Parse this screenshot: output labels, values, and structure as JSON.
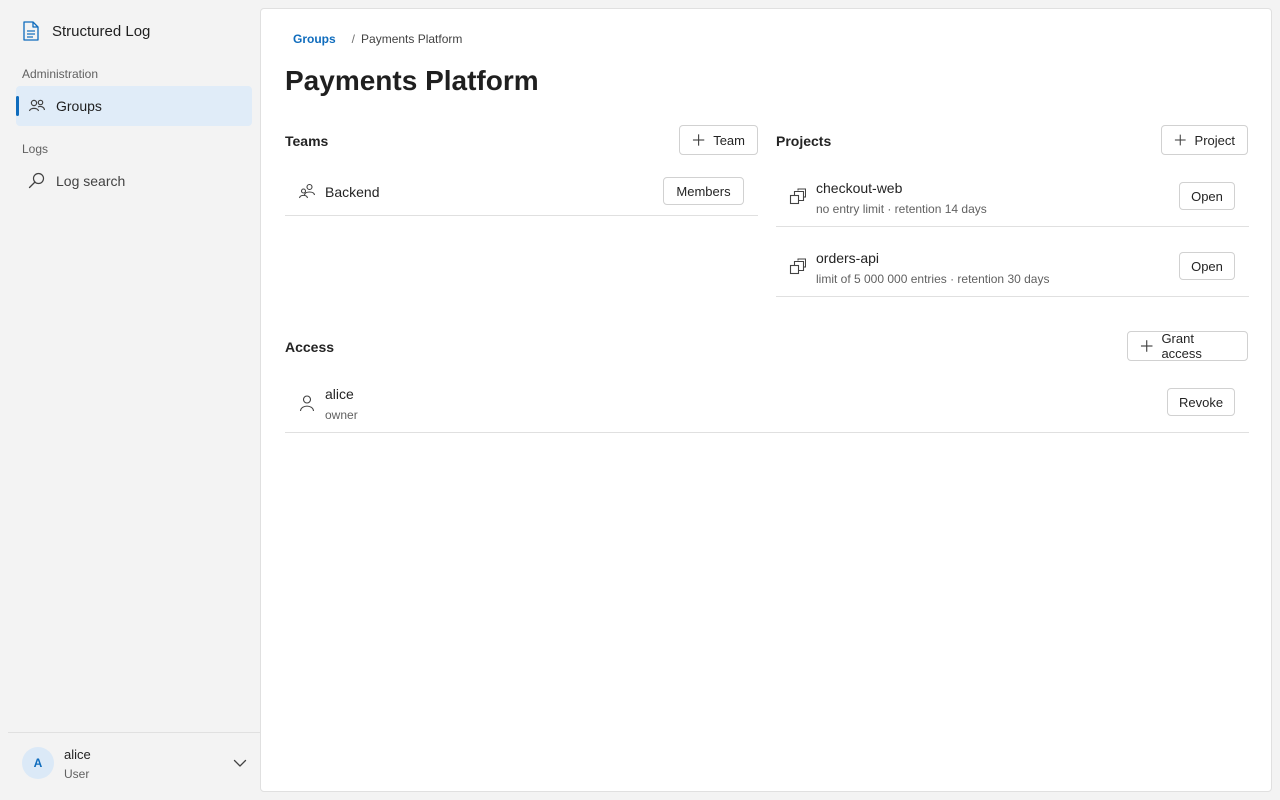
{
  "app": {
    "title": "Structured Log"
  },
  "sidebar": {
    "sections": [
      {
        "heading": "Administration",
        "items": [
          {
            "label": "Groups",
            "icon": "people-icon",
            "active": true
          }
        ]
      },
      {
        "heading": "Logs",
        "items": [
          {
            "label": "Log search",
            "icon": "search-icon",
            "active": false
          }
        ]
      }
    ]
  },
  "user": {
    "initial": "A",
    "name": "alice",
    "role": "User"
  },
  "breadcrumb": {
    "root": "Groups",
    "separator": "/",
    "current": "Payments Platform"
  },
  "page": {
    "title": "Payments Platform"
  },
  "teams": {
    "title": "Teams",
    "add_label": "Team",
    "items": [
      {
        "name": "Backend",
        "action": "Members"
      }
    ]
  },
  "projects": {
    "title": "Projects",
    "add_label": "Project",
    "items": [
      {
        "name": "checkout-web",
        "details": "no entry limit · retention 14 days",
        "action": "Open"
      },
      {
        "name": "orders-api",
        "details": "limit of 5 000 000 entries · retention 30 days",
        "action": "Open"
      }
    ]
  },
  "access": {
    "title": "Access",
    "add_label": "Grant access",
    "items": [
      {
        "name": "alice",
        "role": "owner",
        "action": "Revoke"
      }
    ]
  },
  "colors": {
    "accent": "#0f6cbd",
    "active_bg": "#e0ecf8",
    "border": "#e0e0e0"
  }
}
